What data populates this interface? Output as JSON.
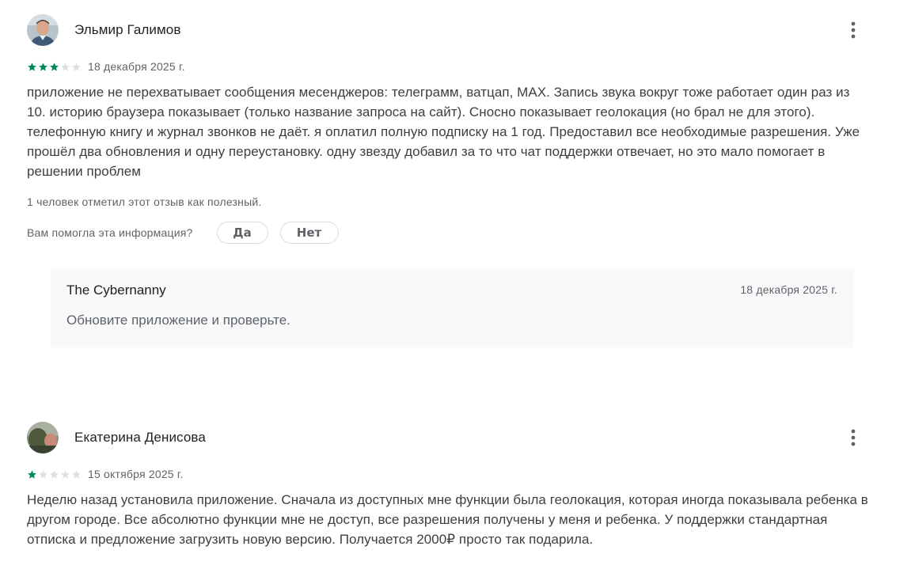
{
  "reviews": [
    {
      "author": "Эльмир Галимов",
      "rating": 3,
      "max_rating": 5,
      "date": "18 декабря 2025 г.",
      "text": "приложение не перехватывает сообщения месенджеров: телеграмм, ватцап, MAX. Запись звука вокруг тоже работает один раз из 10. историю браузера показывает (только название запроса на сайт). Сносно показывает геолокация (но брал не для этого). телефонную книгу и журнал звонков не даёт. я оплатил полную подписку на 1 год. Предоставил все необходимые разрешения. Уже прошёл два обновления и одну переустановку. одну звезду добавил за то что чат поддержки отвечает, но это мало помогает в решении проблем",
      "helpful_count_text": "1 человек отметил этот отзыв как полезный.",
      "helpful_question": "Вам помогла эта информация?",
      "yes_label": "Да",
      "no_label": "Нет",
      "reply": {
        "author": "The Cybernanny",
        "date": "18 декабря 2025 г.",
        "text": "Обновите приложение и проверьте."
      }
    },
    {
      "author": "Екатерина Денисова",
      "rating": 1,
      "max_rating": 5,
      "date": "15 октября 2025 г.",
      "text": "Неделю назад установила приложение. Сначала из доступных мне функции была геолокация, которая иногда показывала ребенка в другом городе. Все абсолютно функции мне не доступ, все разрешения получены у меня и ребенка. У поддержки стандартная отписка и предложение загрузить новую версию. Получается 2000₽ просто так подарила."
    }
  ],
  "colors": {
    "star_filled": "#01875f",
    "star_empty": "#e0e0e0",
    "reply_bg": "#f8f9fa"
  },
  "icons": {
    "more": "more-vert-icon",
    "star": "star-icon"
  }
}
